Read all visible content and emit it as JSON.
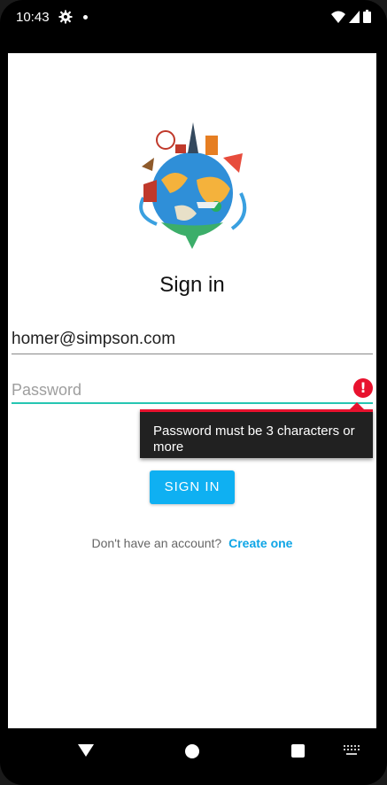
{
  "status_bar": {
    "time": "10:43",
    "icons": [
      "gear-icon",
      "notification-dot",
      "wifi-icon",
      "signal-icon",
      "battery-icon"
    ]
  },
  "logo": {
    "icon": "globe-travel-logo"
  },
  "title": "Sign in",
  "email": {
    "value": "homer@simpson.com"
  },
  "password": {
    "placeholder": "Password",
    "error_icon": "!"
  },
  "error_tooltip": "Password must be 3 characters or more",
  "signin_button": "SIGN IN",
  "signup": {
    "prompt": "Don't have an account?",
    "link": "Create one"
  },
  "colors": {
    "accent": "#0fb0f2",
    "error": "#e8122e",
    "focus_underline": "#26c6b2",
    "link": "#0ea5e6"
  }
}
